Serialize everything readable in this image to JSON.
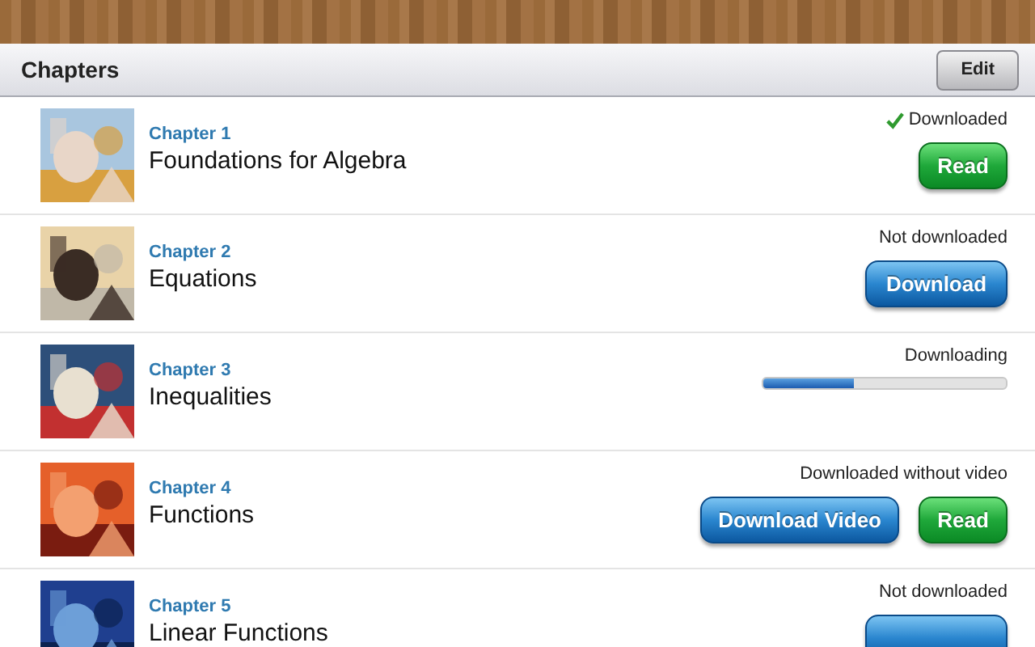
{
  "toolbar": {
    "title": "Chapters",
    "edit_button": "Edit"
  },
  "chapters": [
    {
      "number": "Chapter 1",
      "title": "Foundations for Algebra",
      "status": "Downloaded",
      "kind": "downloaded",
      "picture": {
        "kind": "picture"
      },
      "actions": [
        {
          "kind": "read",
          "label": "Read"
        }
      ]
    },
    {
      "number": "Chapter 2",
      "title": "Equations",
      "status": "Not downloaded",
      "kind": "other",
      "picture": {
        "kind": "picture"
      },
      "actions": [
        {
          "kind": "download",
          "label": "Download"
        }
      ]
    },
    {
      "number": "Chapter 3",
      "title": "Inequalities",
      "status": "Downloading",
      "kind": "other",
      "progress": {
        "level": 0.37
      },
      "picture": {
        "kind": "picture"
      }
    },
    {
      "number": "Chapter 4",
      "title": "Functions",
      "status": "Downloaded without video",
      "kind": "other",
      "picture": {
        "kind": "picture"
      },
      "actions": [
        {
          "kind": "download",
          "label": "Download Video"
        },
        {
          "kind": "read",
          "label": "Read"
        }
      ]
    },
    {
      "number": "Chapter 5",
      "title": "Linear Functions",
      "status": "Not downloaded",
      "kind": "other",
      "picture": {
        "kind": "picture"
      },
      "actions": [
        {
          "kind": "download"
        }
      ]
    }
  ]
}
